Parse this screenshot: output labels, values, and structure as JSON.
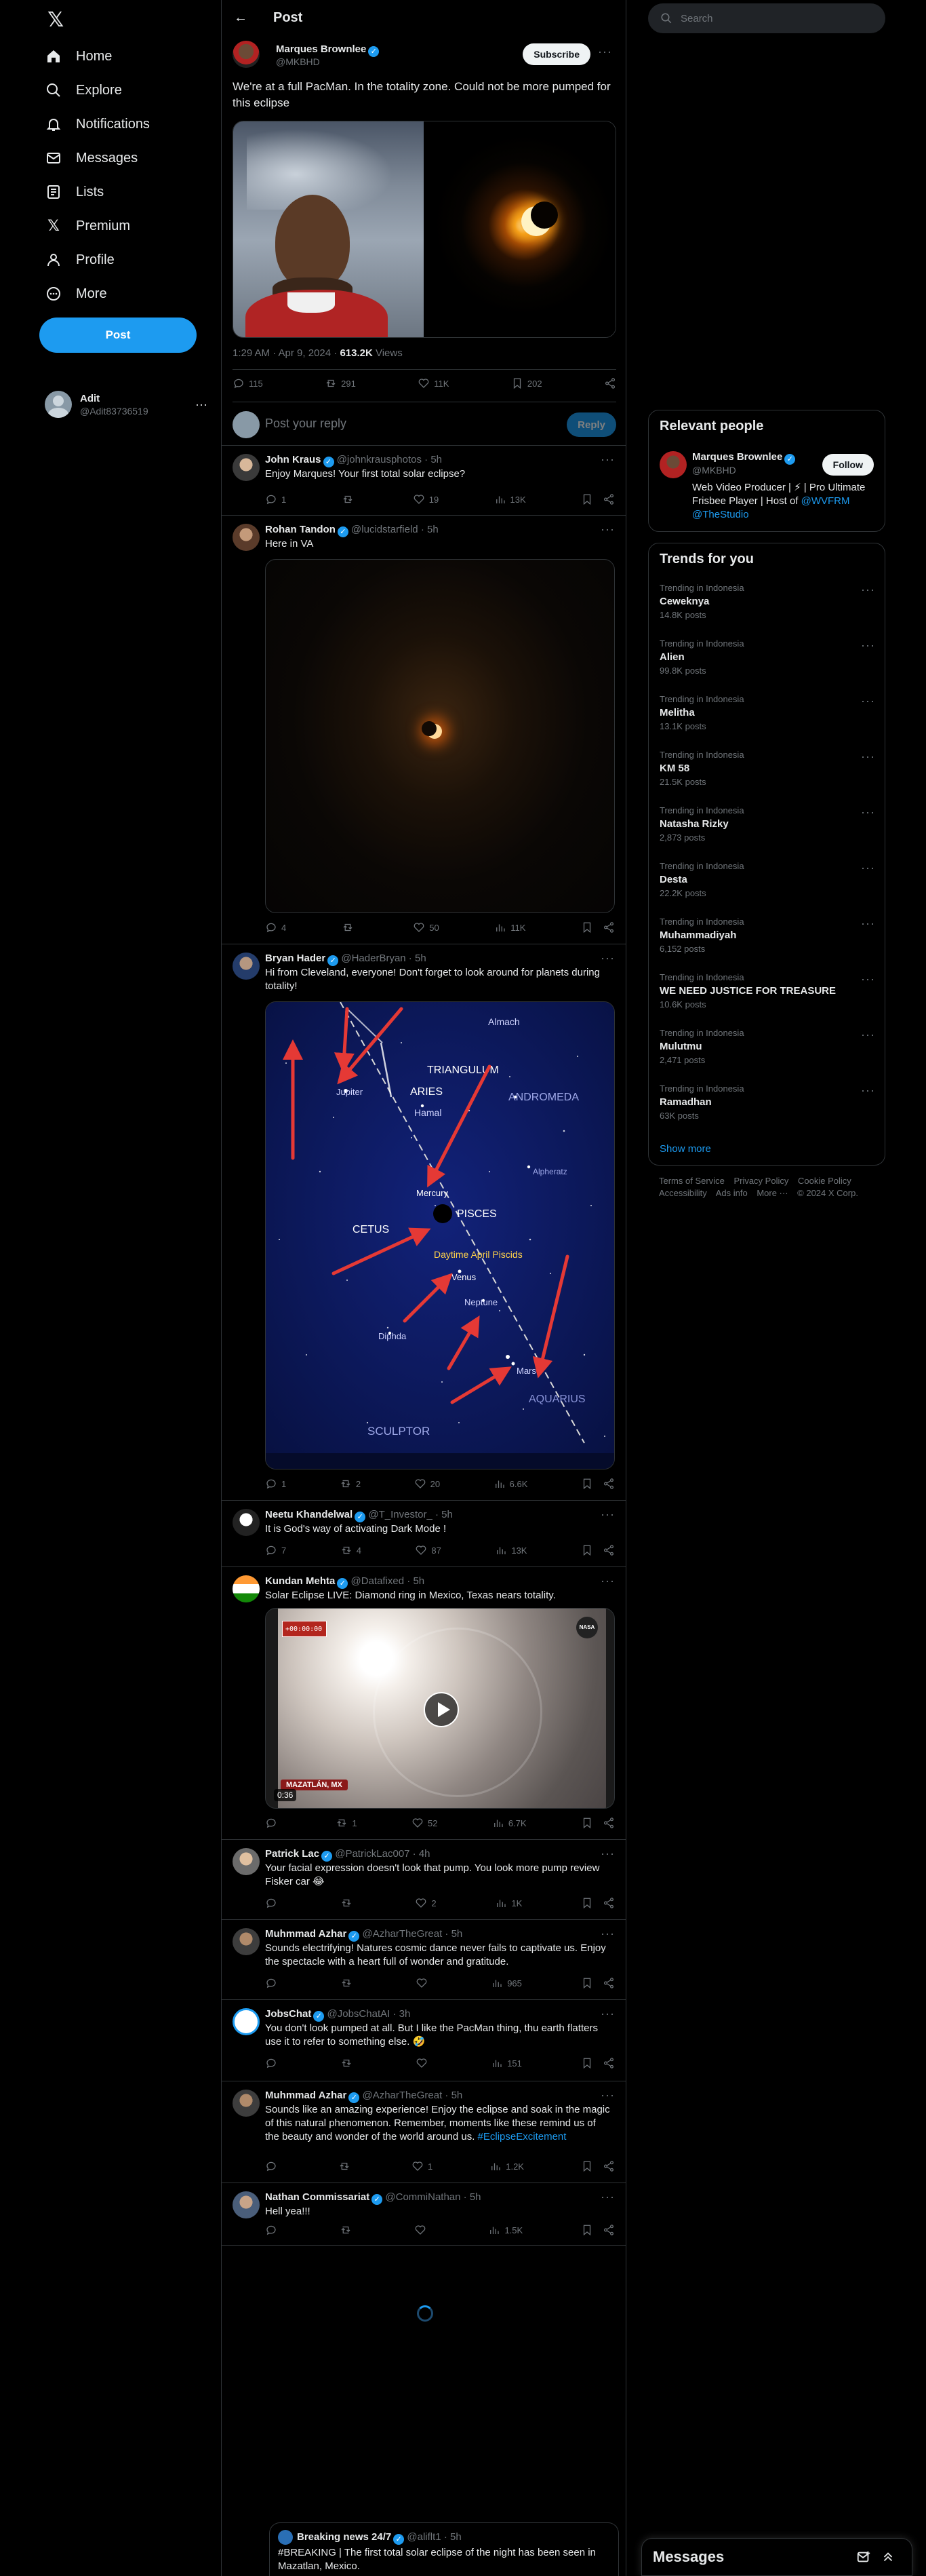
{
  "nav": {
    "items": [
      {
        "label": "Home",
        "icon": "home-icon"
      },
      {
        "label": "Explore",
        "icon": "search-icon"
      },
      {
        "label": "Notifications",
        "icon": "bell-icon"
      },
      {
        "label": "Messages",
        "icon": "envelope-icon"
      },
      {
        "label": "Lists",
        "icon": "list-icon"
      },
      {
        "label": "Premium",
        "icon": "x-logo-icon"
      },
      {
        "label": "Profile",
        "icon": "person-icon"
      },
      {
        "label": "More",
        "icon": "more-circle-icon"
      }
    ],
    "post_label": "Post",
    "account": {
      "name": "Adit",
      "handle": "@Adit83736519"
    }
  },
  "header": {
    "title": "Post"
  },
  "main_post": {
    "name": "Marques Brownlee",
    "handle": "@MKBHD",
    "subscribe_label": "Subscribe",
    "text": "We're at a full PacMan. In the totality zone. Could not be more pumped for this eclipse",
    "time": "1:29 AM · Apr 9, 2024 · ",
    "views": "613.2K",
    "views_label": " Views",
    "stats": {
      "replies": "115",
      "reposts": "291",
      "likes": "11K",
      "bookmarks": "202"
    }
  },
  "reply_box": {
    "placeholder": "Post your reply",
    "button": "Reply"
  },
  "replies": [
    {
      "name": "John Kraus",
      "handle": "@johnkrausphotos · 5h",
      "text": "Enjoy Marques! Your first total solar eclipse?",
      "replies": "1",
      "reposts": "",
      "likes": "19",
      "views": "13K"
    },
    {
      "name": "Rohan Tandon",
      "handle": "@lucidstarfield · 5h",
      "text": "Here in VA",
      "replies": "4",
      "reposts": "",
      "likes": "50",
      "views": "11K"
    },
    {
      "name": "Bryan Hader",
      "handle": "@HaderBryan · 5h",
      "text": "Hi from Cleveland, everyone! Don't forget to look around for planets during totality!",
      "replies": "1",
      "reposts": "2",
      "likes": "20",
      "views": "6.6K",
      "map_labels": {
        "almach": "Almach",
        "triangulum": "TRIANGULUM",
        "jupiter": "Jupiter",
        "aries": "ARIES",
        "hamal": "Hamal",
        "andromeda": "ANDROMEDA",
        "alpheratz": "Alpheratz",
        "mercury": "Mercury",
        "pisces": "PISCES",
        "cetus": "CETUS",
        "daytime": "Daytime April Piscids",
        "venus": "Venus",
        "neptune": "Neptune",
        "diphda": "Diphda",
        "mars": "Mars",
        "aquarius": "AQUARIUS",
        "sculptor": "SCULPTOR"
      }
    },
    {
      "name": "Neetu Khandelwal",
      "handle": "@T_Investor_ · 5h",
      "text": "It is God's way of activating Dark Mode !",
      "replies": "7",
      "reposts": "4",
      "likes": "87",
      "views": "13K"
    },
    {
      "name": "Kundan Mehta",
      "handle": "@Datafixed · 5h",
      "text": "Solar Eclipse LIVE: Diamond ring in Mexico, Texas nears totality.",
      "replies": "",
      "reposts": "1",
      "likes": "52",
      "views": "6.7K",
      "video_time": "0:36",
      "video_location": "MAZATLÁN, MX",
      "video_clock": "+00:00:00",
      "video_logo": "NASA"
    },
    {
      "name": "Patrick Lac",
      "handle": "@PatrickLac007 · 4h",
      "text": "Your facial expression doesn't look that pump. You look more pump review Fisker car 😂",
      "replies": "",
      "reposts": "",
      "likes": "2",
      "views": "1K"
    },
    {
      "name": "Muhmmad Azhar",
      "handle": "@AzharTheGreat · 5h",
      "text": "Sounds electrifying! Natures cosmic dance never fails to captivate us. Enjoy the spectacle with a heart full of wonder and gratitude.",
      "replies": "",
      "reposts": "",
      "likes": "",
      "views": "965"
    },
    {
      "name": "JobsChat",
      "handle": "@JobsChatAI · 3h",
      "text": "You don't look pumped at all. But I like the PacMan thing, thu earth flatters use it to refer to something else. 🤣",
      "replies": "",
      "reposts": "",
      "likes": "",
      "views": "151"
    },
    {
      "name": "Muhmmad Azhar",
      "handle": "@AzharTheGreat · 5h",
      "text": "Sounds like an amazing experience! Enjoy the eclipse and soak in the magic of this natural phenomenon. Remember, moments like these remind us of the beauty and wonder of the world around us. ",
      "hashtag": "#EclipseExcitement",
      "replies": "",
      "reposts": "",
      "likes": "1",
      "views": "1.2K"
    },
    {
      "name": "Nathan Commissariat",
      "handle": "@CommiNathan · 5h",
      "text": "Hell yea!!!",
      "replies": "",
      "reposts": "",
      "likes": "",
      "views": "1.5K"
    }
  ],
  "quoted": {
    "name": "Breaking news 24/7",
    "handle": "@aliflt1 · 5h",
    "text": "#BREAKING | The first total solar eclipse of the night has been seen in Mazatlan, Mexico."
  },
  "right": {
    "search_placeholder": "Search",
    "relevant": {
      "title": "Relevant people",
      "name": "Marques Brownlee",
      "handle": "@MKBHD",
      "bio": "Web Video Producer | ⚡ | Pro Ultimate Frisbee Player | Host of ",
      "bio_link1": "@WVFRM",
      "bio_link2": "@TheStudio",
      "follow_label": "Follow"
    },
    "trends_title": "Trends for you",
    "trends": [
      {
        "context": "Trending in Indonesia",
        "name": "Ceweknya",
        "count": "14.8K posts"
      },
      {
        "context": "Trending in Indonesia",
        "name": "Alien",
        "count": "99.8K posts"
      },
      {
        "context": "Trending in Indonesia",
        "name": "Melitha",
        "count": "13.1K posts"
      },
      {
        "context": "Trending in Indonesia",
        "name": "KM 58",
        "count": "21.5K posts"
      },
      {
        "context": "Trending in Indonesia",
        "name": "Natasha Rizky",
        "count": "2,873 posts"
      },
      {
        "context": "Trending in Indonesia",
        "name": "Desta",
        "count": "22.2K posts"
      },
      {
        "context": "Trending in Indonesia",
        "name": "Muhammadiyah",
        "count": "6,152 posts"
      },
      {
        "context": "Trending in Indonesia",
        "name": "WE NEED JUSTICE FOR TREASURE",
        "count": "10.6K posts"
      },
      {
        "context": "Trending in Indonesia",
        "name": "Mulutmu",
        "count": "2,471 posts"
      },
      {
        "context": "Trending in Indonesia",
        "name": "Ramadhan",
        "count": "63K posts"
      }
    ],
    "show_more": "Show more",
    "footer": {
      "links": [
        "Terms of Service",
        "Privacy Policy",
        "Cookie Policy",
        "Accessibility",
        "Ads info",
        "More ···",
        "© 2024 X Corp."
      ]
    },
    "messages_title": "Messages"
  },
  "colors": {
    "accent": "#1d9bf0",
    "border": "#2f3336",
    "muted": "#71767b"
  }
}
